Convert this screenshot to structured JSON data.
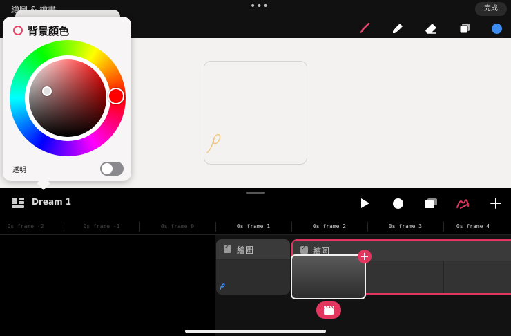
{
  "header": {
    "title": "繪圖 & 繪畫",
    "more": "•••",
    "done_label": "完成"
  },
  "tools": [
    {
      "name": "brush-icon",
      "color": "#e8466c"
    },
    {
      "name": "smudge-icon",
      "color": "#ffffff"
    },
    {
      "name": "eraser-icon",
      "color": "#ffffff"
    },
    {
      "name": "layers-icon",
      "color": "#ffffff"
    },
    {
      "name": "color-swatch",
      "color": "#3d8ef0"
    }
  ],
  "color_picker": {
    "title": "背景顏色",
    "transparent_label": "透明",
    "transparent_on": false,
    "selected_hue_color": "#ff0000"
  },
  "timeline": {
    "scene_name": "Dream 1",
    "frames": [
      "0s frame -2",
      "0s frame -1",
      "0s frame 0",
      "0s frame 1",
      "0s frame 2",
      "0s frame 3",
      "0s frame 4"
    ],
    "active_from_index": 3,
    "layers": [
      {
        "label": "繪圖"
      },
      {
        "label": "繪圖"
      }
    ],
    "add_frame": "+"
  },
  "accent_color": "#e2365f"
}
